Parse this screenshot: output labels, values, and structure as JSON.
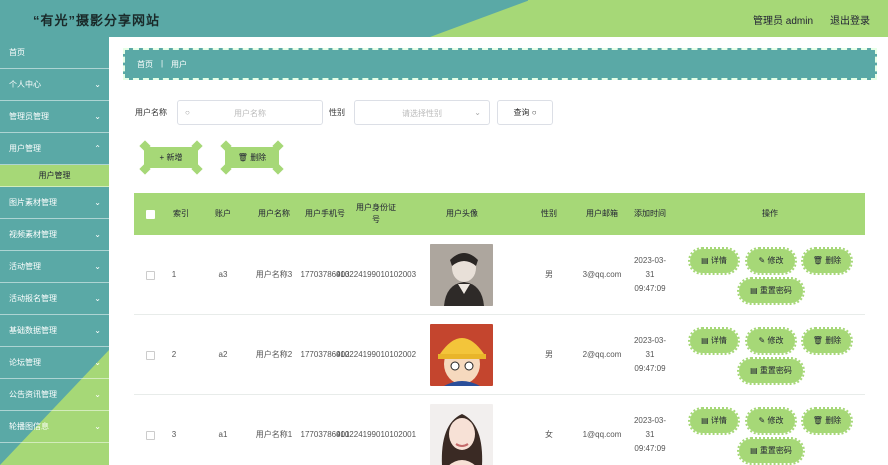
{
  "header": {
    "title": "“有光”摄影分享网站",
    "admin": "管理员 admin",
    "logout": "退出登录"
  },
  "sidebar": {
    "items": [
      {
        "label": "首页",
        "chevron": false
      },
      {
        "label": "个人中心",
        "chevron": true
      },
      {
        "label": "管理员管理",
        "chevron": true
      },
      {
        "label": "用户管理",
        "chevron": true
      },
      {
        "label": "用户管理",
        "sub": true
      },
      {
        "label": "图片素材管理",
        "chevron": true
      },
      {
        "label": "视频素材管理",
        "chevron": true
      },
      {
        "label": "活动管理",
        "chevron": true
      },
      {
        "label": "活动报名管理",
        "chevron": true
      },
      {
        "label": "基础数据管理",
        "chevron": true
      },
      {
        "label": "论坛管理",
        "chevron": true
      },
      {
        "label": "公告资讯管理",
        "chevron": true
      },
      {
        "label": "轮播图信息",
        "chevron": true
      }
    ]
  },
  "breadcrumb": {
    "home": "首页",
    "sep": "|",
    "current": "用户"
  },
  "search": {
    "name_label": "用户名称",
    "name_placeholder": "用户名称",
    "gender_label": "性别",
    "gender_placeholder": "请选择性别",
    "query": "查询"
  },
  "actions": {
    "add": "新增",
    "delete": "删除"
  },
  "table": {
    "headers": {
      "index": "索引",
      "account": "账户",
      "name": "用户名称",
      "phone": "用户手机号",
      "idcard": "用户身份证号",
      "avatar": "用户头像",
      "gender": "性别",
      "email": "用户邮箱",
      "created": "添加时间",
      "ops": "操作"
    },
    "rows": [
      {
        "index": "1",
        "account": "a3",
        "name": "用户名称3",
        "phone": "17703786903",
        "idcard": "410224199010102003",
        "gender": "男",
        "email": "3@qq.com",
        "created": "2023-03-31 09:47:09"
      },
      {
        "index": "2",
        "account": "a2",
        "name": "用户名称2",
        "phone": "17703786902",
        "idcard": "410224199010102002",
        "gender": "男",
        "email": "2@qq.com",
        "created": "2023-03-31 09:47:09"
      },
      {
        "index": "3",
        "account": "a1",
        "name": "用户名称1",
        "phone": "17703786901",
        "idcard": "410224199010102001",
        "gender": "女",
        "email": "1@qq.com",
        "created": "2023-03-31 09:47:09"
      }
    ],
    "ops": {
      "detail": "详情",
      "edit": "修改",
      "delete": "删除",
      "reset": "重置密码"
    }
  },
  "colors": {
    "teal": "#5aa9a6",
    "green": "#a6d877"
  }
}
